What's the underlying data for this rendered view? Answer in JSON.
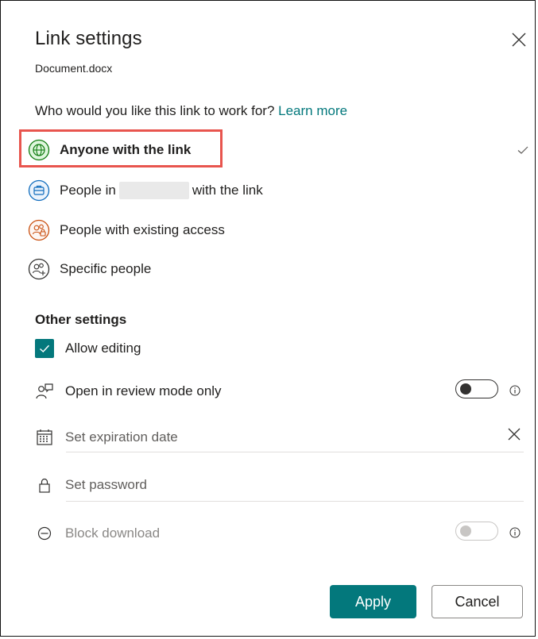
{
  "dialog": {
    "title": "Link settings",
    "filename": "Document.docx"
  },
  "audience": {
    "question": "Who would you like this link to work for?",
    "learn_more": "Learn more",
    "options": [
      {
        "label": "Anyone with the link",
        "selected": true,
        "icon": "globe-icon",
        "color": "#107c10"
      },
      {
        "label_prefix": "People in",
        "label_suffix": "with the link",
        "icon": "briefcase-icon",
        "color": "#0f6cbd"
      },
      {
        "label": "People with existing access",
        "icon": "people-lock-icon",
        "color": "#ca5010"
      },
      {
        "label": "Specific people",
        "icon": "people-add-icon",
        "color": "#323130"
      }
    ]
  },
  "other": {
    "heading": "Other settings",
    "allow_editing": "Allow editing",
    "review_mode": "Open in review mode only",
    "expiration": "Set expiration date",
    "password": "Set password",
    "block_download": "Block download"
  },
  "buttons": {
    "apply": "Apply",
    "cancel": "Cancel"
  },
  "colors": {
    "accent": "#03787c",
    "highlight": "#e8554e"
  }
}
